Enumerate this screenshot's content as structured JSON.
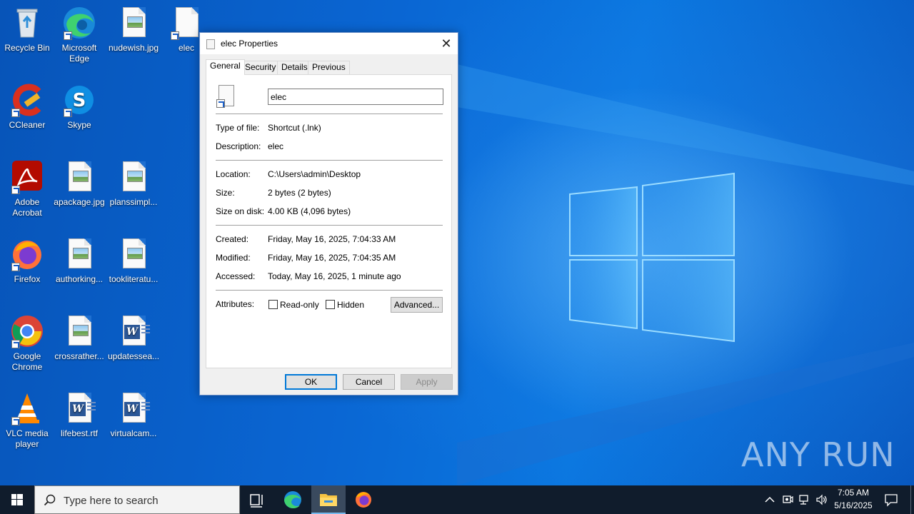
{
  "desktop": {
    "icons": [
      {
        "label": "Recycle Bin"
      },
      {
        "label": "Microsoft Edge"
      },
      {
        "label": "nudewish.jpg"
      },
      {
        "label": "elec"
      },
      {
        "label": "CCleaner"
      },
      {
        "label": "Skype"
      },
      {
        "label": "Adobe Acrobat"
      },
      {
        "label": "apackage.jpg"
      },
      {
        "label": "planssimpl..."
      },
      {
        "label": "Firefox"
      },
      {
        "label": "authorking..."
      },
      {
        "label": "tookliteratu..."
      },
      {
        "label": "Google Chrome"
      },
      {
        "label": "crossrather..."
      },
      {
        "label": "updatessea..."
      },
      {
        "label": "VLC media player"
      },
      {
        "label": "lifebest.rtf"
      },
      {
        "label": "virtualcam..."
      }
    ]
  },
  "dialog": {
    "title": "elec Properties",
    "close_glyph": "✕",
    "tabs": [
      "General",
      "Security",
      "Details",
      "Previous Versions"
    ],
    "name_value": "elec",
    "fields": {
      "type_label": "Type of file:",
      "type_value": "Shortcut (.lnk)",
      "desc_label": "Description:",
      "desc_value": "elec",
      "location_label": "Location:",
      "location_value": "C:\\Users\\admin\\Desktop",
      "size_label": "Size:",
      "size_value": "2 bytes (2 bytes)",
      "disk_label": "Size on disk:",
      "disk_value": "4.00 KB (4,096 bytes)",
      "created_label": "Created:",
      "created_value": "Friday, May 16, 2025, 7:04:33 AM",
      "modified_label": "Modified:",
      "modified_value": "Friday, May 16, 2025, 7:04:35 AM",
      "accessed_label": "Accessed:",
      "accessed_value": "Today, May 16, 2025, 1 minute ago",
      "attributes_label": "Attributes:"
    },
    "readonly_label": "Read-only",
    "hidden_label": "Hidden",
    "advanced_label": "Advanced...",
    "ok_label": "OK",
    "cancel_label": "Cancel",
    "apply_label": "Apply"
  },
  "watermark": "ANY RUN",
  "taskbar": {
    "search_placeholder": "Type here to search",
    "clock_time": "7:05 AM",
    "clock_date": "5/16/2025"
  }
}
